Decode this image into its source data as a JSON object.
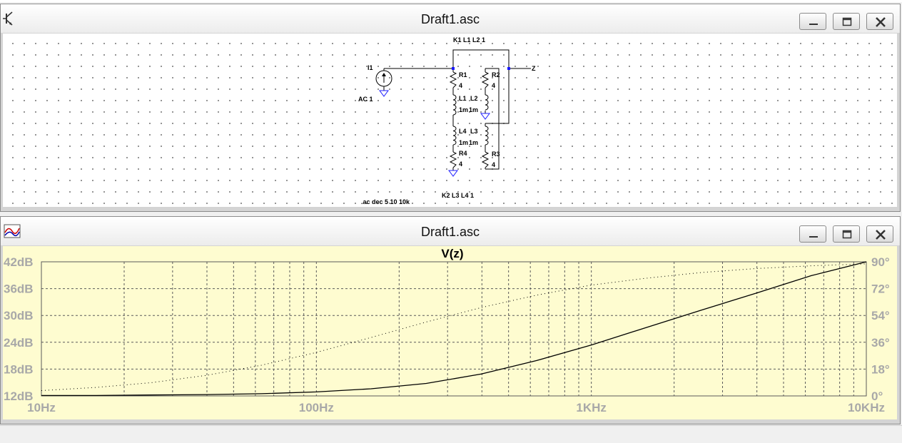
{
  "schematic_window": {
    "title": "Draft1.asc",
    "icon": "schematic-transistor-icon",
    "labels": {
      "k1": "K1 L1 L2 1",
      "k2": "K2 L3 L4 1",
      "i1": "I1",
      "ac": "AC 1",
      "z": "Z",
      "r1": "R1",
      "r1v": "4",
      "r2": "R2",
      "r2v": "4",
      "r3": "R3",
      "r3v": "4",
      "r4": "R4",
      "r4v": "4",
      "l1": "L1",
      "l1v": "1m",
      "l2": "L2",
      "l2v": "1m",
      "l3": "L3",
      "l3v": "1m",
      "l4": "L4",
      "l4v": "1m",
      "directive": ".ac dec 5 10 10k"
    }
  },
  "plot_window": {
    "title": "Draft1.asc",
    "icon": "waveform-plot-icon"
  },
  "window_controls": {
    "minimize": "minimize-icon",
    "maximize": "maximize-icon",
    "close": "close-icon"
  },
  "colors": {
    "plot_background": "#fefcd0",
    "grid": "#5a5a5a",
    "axis_text": "#a8a8a8",
    "trace": "#000000",
    "node_marker": "#1a1aff",
    "ground": "#2020ff"
  },
  "chart_data": {
    "type": "line",
    "title": "V(z)",
    "x_scale": "log",
    "xlim": [
      10,
      10000
    ],
    "x_ticks": [
      "10Hz",
      "100Hz",
      "1KHz",
      "10KHz"
    ],
    "y_left_ticks": [
      "42dB",
      "36dB",
      "30dB",
      "24dB",
      "18dB",
      "12dB"
    ],
    "y_right_ticks": [
      "90°",
      "72°",
      "54°",
      "36°",
      "18°",
      "0°"
    ],
    "ylim_left": [
      12,
      42
    ],
    "ylim_right": [
      0,
      90
    ],
    "series": [
      {
        "style": "solid",
        "axis": "left",
        "x": [
          10,
          15.8,
          25.1,
          39.8,
          63.1,
          100,
          158,
          251,
          398,
          631,
          1000,
          1585,
          2512,
          3981,
          6310,
          10000
        ],
        "y": [
          12.1,
          12.1,
          12.2,
          12.3,
          12.5,
          12.9,
          13.6,
          14.8,
          16.9,
          19.9,
          23.4,
          27.3,
          31.2,
          35.0,
          38.9,
          42.0
        ]
      },
      {
        "style": "dotted",
        "axis": "right",
        "x": [
          10,
          15.8,
          25.1,
          39.8,
          63.1,
          100,
          158,
          251,
          398,
          631,
          1000,
          1585,
          2512,
          3981,
          6310,
          10000
        ],
        "y": [
          3.6,
          5.7,
          8.9,
          13.8,
          20.6,
          29.2,
          39.2,
          49.6,
          59.3,
          67.6,
          74.4,
          79.0,
          82.8,
          85.5,
          87.3,
          88.6
        ]
      }
    ]
  }
}
